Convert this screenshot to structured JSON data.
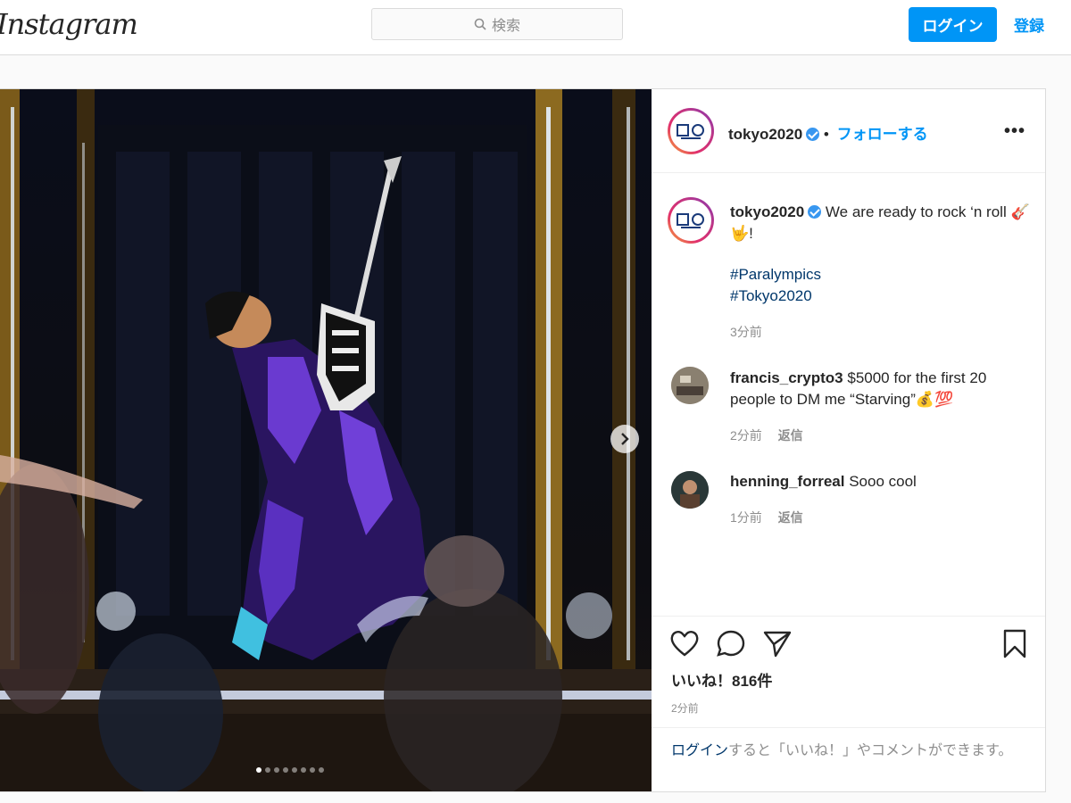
{
  "nav": {
    "logo": "Instagram",
    "search_placeholder": "検索",
    "login": "ログイン",
    "register": "登録"
  },
  "post": {
    "username": "tokyo2020",
    "follow": "フォローする",
    "separator": "•",
    "more": "•••",
    "caption": {
      "username": "tokyo2020",
      "text": "We are ready to rock ‘n roll 🎸🤟!",
      "hashtags": [
        "#Paralympics",
        "#Tokyo2020"
      ],
      "time": "3分前"
    },
    "comments": [
      {
        "username": "francis_crypto3",
        "text": "$5000 for the first 20 people to DM me “Starving”💰💯",
        "time": "2分前",
        "reply": "返信"
      },
      {
        "username": "henning_forreal",
        "text": "Sooo cool",
        "time": "1分前",
        "reply": "返信"
      }
    ],
    "likes": "いいね！816件",
    "post_time": "2分前",
    "login_hint_link": "ログイン",
    "login_hint_rest": "すると「いいね！」やコメントができます。",
    "carousel": {
      "count": 8,
      "active_index": 0
    },
    "colors": {
      "accent": "#0095f6",
      "verified": "#3897f0",
      "hashtag": "#00376b"
    },
    "icons": [
      "heart-icon",
      "comment-icon",
      "share-icon",
      "bookmark-icon",
      "search-icon",
      "chevron-right-icon",
      "verified-icon",
      "more-icon"
    ]
  }
}
